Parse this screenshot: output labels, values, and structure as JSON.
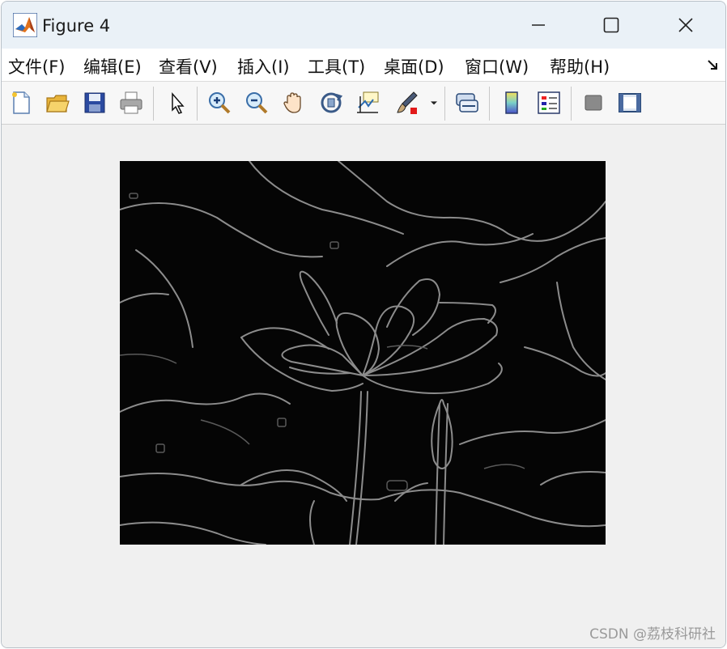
{
  "window": {
    "title": "Figure 4"
  },
  "menu": [
    "文件(F)",
    "编辑(E)",
    "查看(V)",
    "插入(I)",
    "工具(T)",
    "桌面(D)",
    "窗口(W)",
    "帮助(H)"
  ],
  "toolbar": {
    "items": [
      {
        "icon": "new-figure-icon"
      },
      {
        "icon": "open-file-icon"
      },
      {
        "icon": "save-icon"
      },
      {
        "icon": "print-icon"
      },
      {
        "icon": "edit-plot-arrow-icon"
      },
      {
        "icon": "zoom-in-icon"
      },
      {
        "icon": "zoom-out-icon"
      },
      {
        "icon": "pan-hand-icon"
      },
      {
        "icon": "rotate-3d-icon"
      },
      {
        "icon": "data-cursor-icon"
      },
      {
        "icon": "brush-icon"
      },
      {
        "icon": "link-plot-icon"
      },
      {
        "icon": "colorbar-icon"
      },
      {
        "icon": "legend-icon"
      },
      {
        "icon": "hide-plot-tools-icon"
      },
      {
        "icon": "show-plot-tools-icon"
      }
    ]
  },
  "figure": {
    "image_description_icon": "edge-detected-lotus-image"
  },
  "watermark": "CSDN @荔枝科研社"
}
